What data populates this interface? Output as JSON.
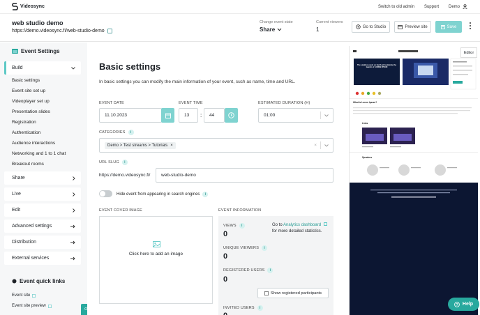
{
  "app": {
    "name": "Videosync"
  },
  "topnav": {
    "switch_admin": "Switch to old admin",
    "support": "Support",
    "user": "Demo"
  },
  "event": {
    "title": "web studio demo",
    "url": "https://demo.videosync.fi/web-studio-demo",
    "state_label": "Change event state",
    "state_value": "Share",
    "viewers_label": "Current viewers",
    "viewers_value": "1"
  },
  "actions": {
    "go_to_studio": "Go to Studio",
    "preview_site": "Preview site",
    "save": "Save"
  },
  "sidebar": {
    "heading": "Event Settings",
    "build_label": "Build",
    "build_subitems": [
      "Basic settings",
      "Event site set up",
      "Videoplayer set up",
      "Presentation slides",
      "Registration",
      "Authentication",
      "Audience interactions",
      "Networking and 1 to 1 chat",
      "Breakout rooms"
    ],
    "sections": [
      "Share",
      "Live",
      "Edit",
      "Advanced settings",
      "Distribution",
      "External services"
    ],
    "quick_links_heading": "Event quick links",
    "quick_links": [
      "Event site",
      "Event site preview"
    ],
    "open_editor": "Open editor"
  },
  "main": {
    "title": "Basic settings",
    "description": "In basic settings you can modify the main information of your event, such as name, time and URL.",
    "event_date_label": "EVENT DATE",
    "event_date": "11.10.2023",
    "event_time_label": "EVENT TIME",
    "event_hour": "13",
    "event_minute": "44",
    "duration_label": "ESTIMATED DURATION (H)",
    "duration": "01:00",
    "categories_label": "CATEGORIES",
    "category_chip": "Demo > Test streams > Tutorials",
    "url_slug_label": "URL SLUG",
    "url_prefix": "https://demo.videosync.fi/",
    "url_slug": "web-studio-demo",
    "hide_toggle_label": "Hide event from appearing in search engines",
    "cover_label": "EVENT COVER IMAGE",
    "cover_text": "Click here to add an image",
    "info_label": "EVENT INFORMATION",
    "views_label": "VIEWS",
    "views": "0",
    "unique_label": "UNIQUE VIEWERS",
    "unique": "0",
    "registered_label": "REGISTERED USERS",
    "registered": "0",
    "invited_label": "INVITED USERS",
    "invited": "0",
    "analytics_prefix": "Go to",
    "analytics_link": "Analytics dashboard",
    "analytics_suffix": "for more detailed statistics.",
    "show_registered": "Show registered participants"
  },
  "preview": {
    "editor_tag": "Editor",
    "hero_text": "The smallest event on Earth will celebrate the launch of LOREM IPSUM",
    "section_intro": "What is Lorem Ipsum?",
    "links_title": "Links",
    "speakers_title": "Speakers"
  },
  "help": {
    "label": "Help"
  }
}
